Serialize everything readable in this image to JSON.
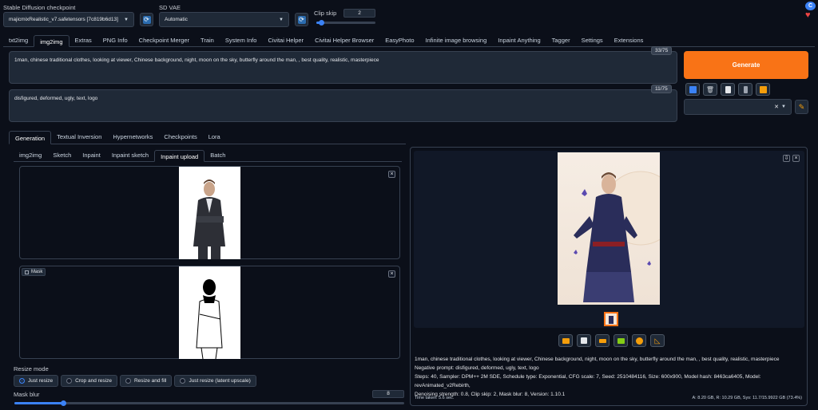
{
  "header": {
    "checkpoint_label": "Stable Diffusion checkpoint",
    "checkpoint_value": "majicmixRealistic_v7.safetensors [7c819b6d13]",
    "vae_label": "SD VAE",
    "vae_value": "Automatic",
    "clipskip_label": "Clip skip",
    "clipskip_value": "2",
    "clipskip_fraction": 0.08
  },
  "main_tabs": [
    "txt2img",
    "img2img",
    "Extras",
    "PNG Info",
    "Checkpoint Merger",
    "Train",
    "System Info",
    "Civitai Helper",
    "Civitai Helper Browser",
    "EasyPhoto",
    "Infinite image browsing",
    "Inpaint Anything",
    "Tagger",
    "Settings",
    "Extensions"
  ],
  "prompt": {
    "positive": "1man, chinese traditional clothes, looking at viewer, Chinese background, night, moon on the sky, butterfly around the man, , best quality, realistic, masterpiece",
    "positive_count": "33/75",
    "negative": "disfigured, deformed, ugly, text, logo",
    "negative_count": "11/75"
  },
  "generate_label": "Generate",
  "sub_tabs": [
    "Generation",
    "Textual Inversion",
    "Hypernetworks",
    "Checkpoints",
    "Lora"
  ],
  "mode_tabs": [
    "img2img",
    "Sketch",
    "Inpaint",
    "Inpaint sketch",
    "Inpaint upload",
    "Batch"
  ],
  "mask_label": "Mask",
  "resize_mode": {
    "label": "Resize mode",
    "options": [
      "Just resize",
      "Crop and resize",
      "Resize and fill",
      "Just resize (latent upscale)"
    ]
  },
  "mask_blur": {
    "label": "Mask blur",
    "value": "8",
    "fraction": 0.125
  },
  "output": {
    "info_prompt": "1man, chinese traditional clothes, looking at viewer, Chinese background, night, moon on the sky, butterfly around the man, , best quality, realistic, masterpiece",
    "info_negative": "Negative prompt: disfigured, deformed, ugly, text, logo",
    "info_params": "Steps: 40, Sampler: DPM++ 2M SDE, Schedule type: Exponential, CFG scale: 7, Seed: 2510484116, Size: 600x900, Model hash: 8463ca6405, Model: revAnimated_v2Rebirth,",
    "info_params2": "Denoising strength: 0.8, Clip skip: 2, Mask blur: 8, Version: 1.10.1",
    "time_taken": "Time taken: 5.6 sec.",
    "vram": "A: 8.20 GB, R: 10.29 GB, Sys: 11.7/15.9922 GB (73.4%)"
  },
  "colors": {
    "accent": "#f97316",
    "bg": "#0b0f19",
    "panel": "#1f2937",
    "blue": "#3b82f6"
  }
}
